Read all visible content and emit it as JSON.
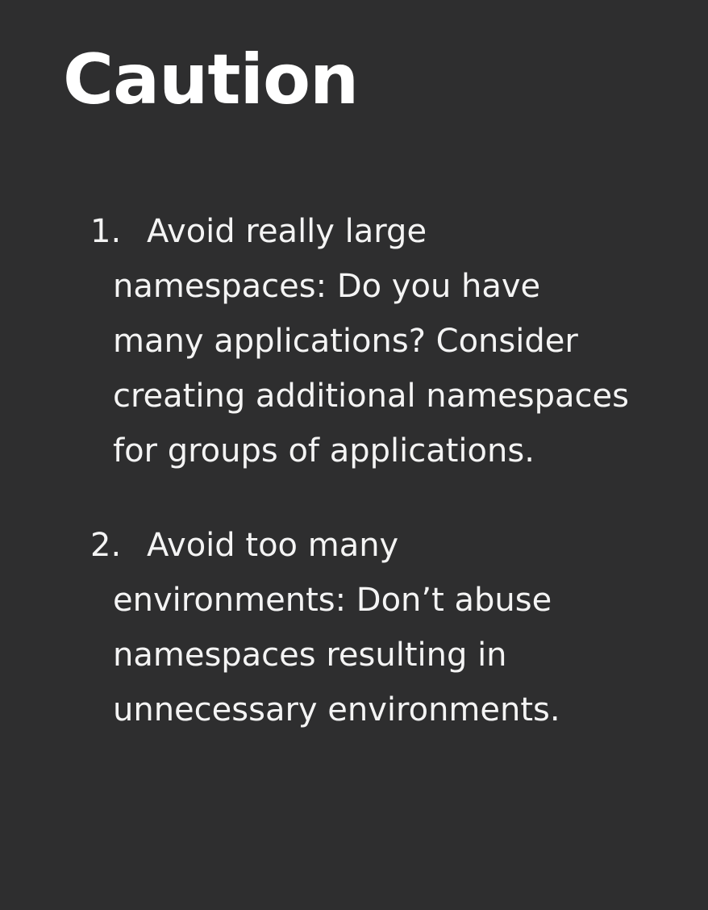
{
  "slide": {
    "title": "Caution",
    "items": [
      {
        "number": "1.",
        "lines": [
          "Avoid really large",
          "namespaces: Do you have",
          "many applications? Consider",
          "creating additional namespaces",
          "for groups of applications."
        ]
      },
      {
        "number": "2.",
        "lines": [
          "Avoid too many",
          "environments: Don’t abuse",
          "namespaces resulting in",
          "unnecessary environments."
        ]
      }
    ]
  }
}
